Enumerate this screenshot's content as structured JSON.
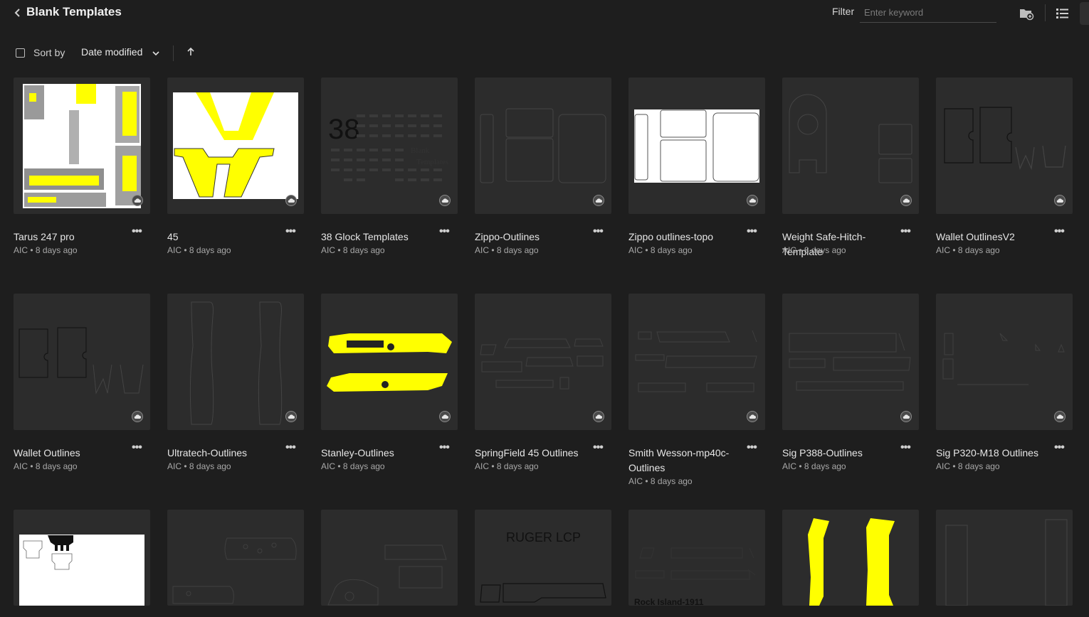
{
  "header": {
    "title": "Blank Templates",
    "filter_label": "Filter",
    "filter_placeholder": "Enter keyword",
    "filter_value": ""
  },
  "sortbar": {
    "sort_label": "Sort by",
    "sort_value": "Date modified",
    "sort_direction": "ascending"
  },
  "colors": {
    "background": "#1e1e1e",
    "thumb_bg": "#2c2c2c",
    "accent_yellow": "#ffff00"
  },
  "files": [
    {
      "name": "Tarus 247 pro",
      "owner": "AIC",
      "modified": "8 days ago"
    },
    {
      "name": "45",
      "owner": "AIC",
      "modified": "8 days ago"
    },
    {
      "name": "38 Glock Templates",
      "owner": "AIC",
      "modified": "8 days ago"
    },
    {
      "name": "Zippo-Outlines",
      "owner": "AIC",
      "modified": "8 days ago"
    },
    {
      "name": "Zippo outlines-topo",
      "owner": "AIC",
      "modified": "8 days ago"
    },
    {
      "name": "Weight Safe-Hitch-Template",
      "owner": "AIC",
      "modified": "8 days ago"
    },
    {
      "name": "Wallet OutlinesV2",
      "owner": "AIC",
      "modified": "8 days ago"
    },
    {
      "name": "Wallet Outlines",
      "owner": "AIC",
      "modified": "8 days ago"
    },
    {
      "name": "Ultratech-Outlines",
      "owner": "AIC",
      "modified": "8 days ago"
    },
    {
      "name": "Stanley-Outlines",
      "owner": "AIC",
      "modified": "8 days ago"
    },
    {
      "name": "SpringField 45 Outlines",
      "owner": "AIC",
      "modified": "8 days ago"
    },
    {
      "name": "Smith Wesson-mp40c-Outlines",
      "owner": "AIC",
      "modified": "8 days ago"
    },
    {
      "name": "Sig P388-Outlines",
      "owner": "AIC",
      "modified": "8 days ago"
    },
    {
      "name": "Sig P320-M18 Outlines",
      "owner": "AIC",
      "modified": "8 days ago"
    }
  ],
  "thumbnail_texts": {
    "glock_number": "38",
    "glock_caption_1": "Blank",
    "glock_caption_2": "Templates",
    "ruger": "RUGER LCP",
    "rock_island": "Rock Island-1911"
  },
  "icons": [
    "chevron-left-icon",
    "new-folder-icon",
    "list-view-icon",
    "chevron-down-icon",
    "arrow-up-icon",
    "cloud-icon",
    "more-icon"
  ]
}
